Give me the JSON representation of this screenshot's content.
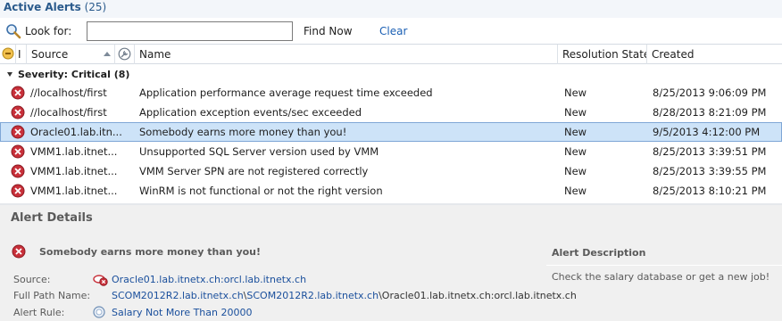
{
  "window": {
    "title": "Active Alerts",
    "count": "(25)"
  },
  "search": {
    "label": "Look for:",
    "value": "",
    "find_label": "Find Now",
    "clear_label": "Clear"
  },
  "columns": {
    "icon1": "",
    "icon2": "I",
    "source": "Source",
    "name": "Name",
    "resolution": "Resolution State",
    "created": "Created"
  },
  "group": {
    "label": "Severity: Critical (8)"
  },
  "alerts": [
    {
      "source": "//localhost/first",
      "name": "Application performance average request time exceeded",
      "state": "New",
      "created": "8/25/2013 9:06:09 PM"
    },
    {
      "source": "//localhost/first",
      "name": "Application exception events/sec exceeded",
      "state": "New",
      "created": "8/28/2013 8:21:09 PM"
    },
    {
      "source": "Oracle01.lab.itn...",
      "name": "Somebody earns more money than you!",
      "state": "New",
      "created": "9/5/2013 4:12:00 PM"
    },
    {
      "source": "VMM1.lab.itnet...",
      "name": "Unsupported SQL Server version used by VMM",
      "state": "New",
      "created": "8/25/2013 3:39:51 PM"
    },
    {
      "source": "VMM1.lab.itnet...",
      "name": "VMM Server SPN are not registered correctly",
      "state": "New",
      "created": "8/25/2013 3:39:55 PM"
    },
    {
      "source": "VMM1.lab.itnet...",
      "name": "WinRM is not functional or not the right version",
      "state": "New",
      "created": "8/25/2013 8:10:21 PM"
    }
  ],
  "selected_row": 2,
  "details": {
    "title": "Alert Details",
    "subject": "Somebody earns more money than you!",
    "source_label": "Source:",
    "source_value": "Oracle01.lab.itnetx.ch:orcl.lab.itnetx.ch",
    "fullpath_label": "Full Path Name:",
    "fullpath_link1": "SCOM2012R2.lab.itnetx.ch",
    "fullpath_sep1": "\\",
    "fullpath_link2": "SCOM2012R2.lab.itnetx.ch",
    "fullpath_sep2": "\\",
    "fullpath_rest": "Oracle01.lab.itnetx.ch:orcl.lab.itnetx.ch",
    "rule_label": "Alert Rule:",
    "rule_value": "Salary Not More Than 20000",
    "description_title": "Alert Description",
    "description_text": "Check the salary database or get a new job!"
  },
  "colors": {
    "accent": "#1a5fb4",
    "selection": "#cde3f8",
    "error": "#c8303a",
    "panel": "#f0f0f0"
  },
  "icons": {
    "search": "search-icon",
    "error": "critical-error-icon",
    "state": "state-icon",
    "rule": "rule-icon"
  }
}
